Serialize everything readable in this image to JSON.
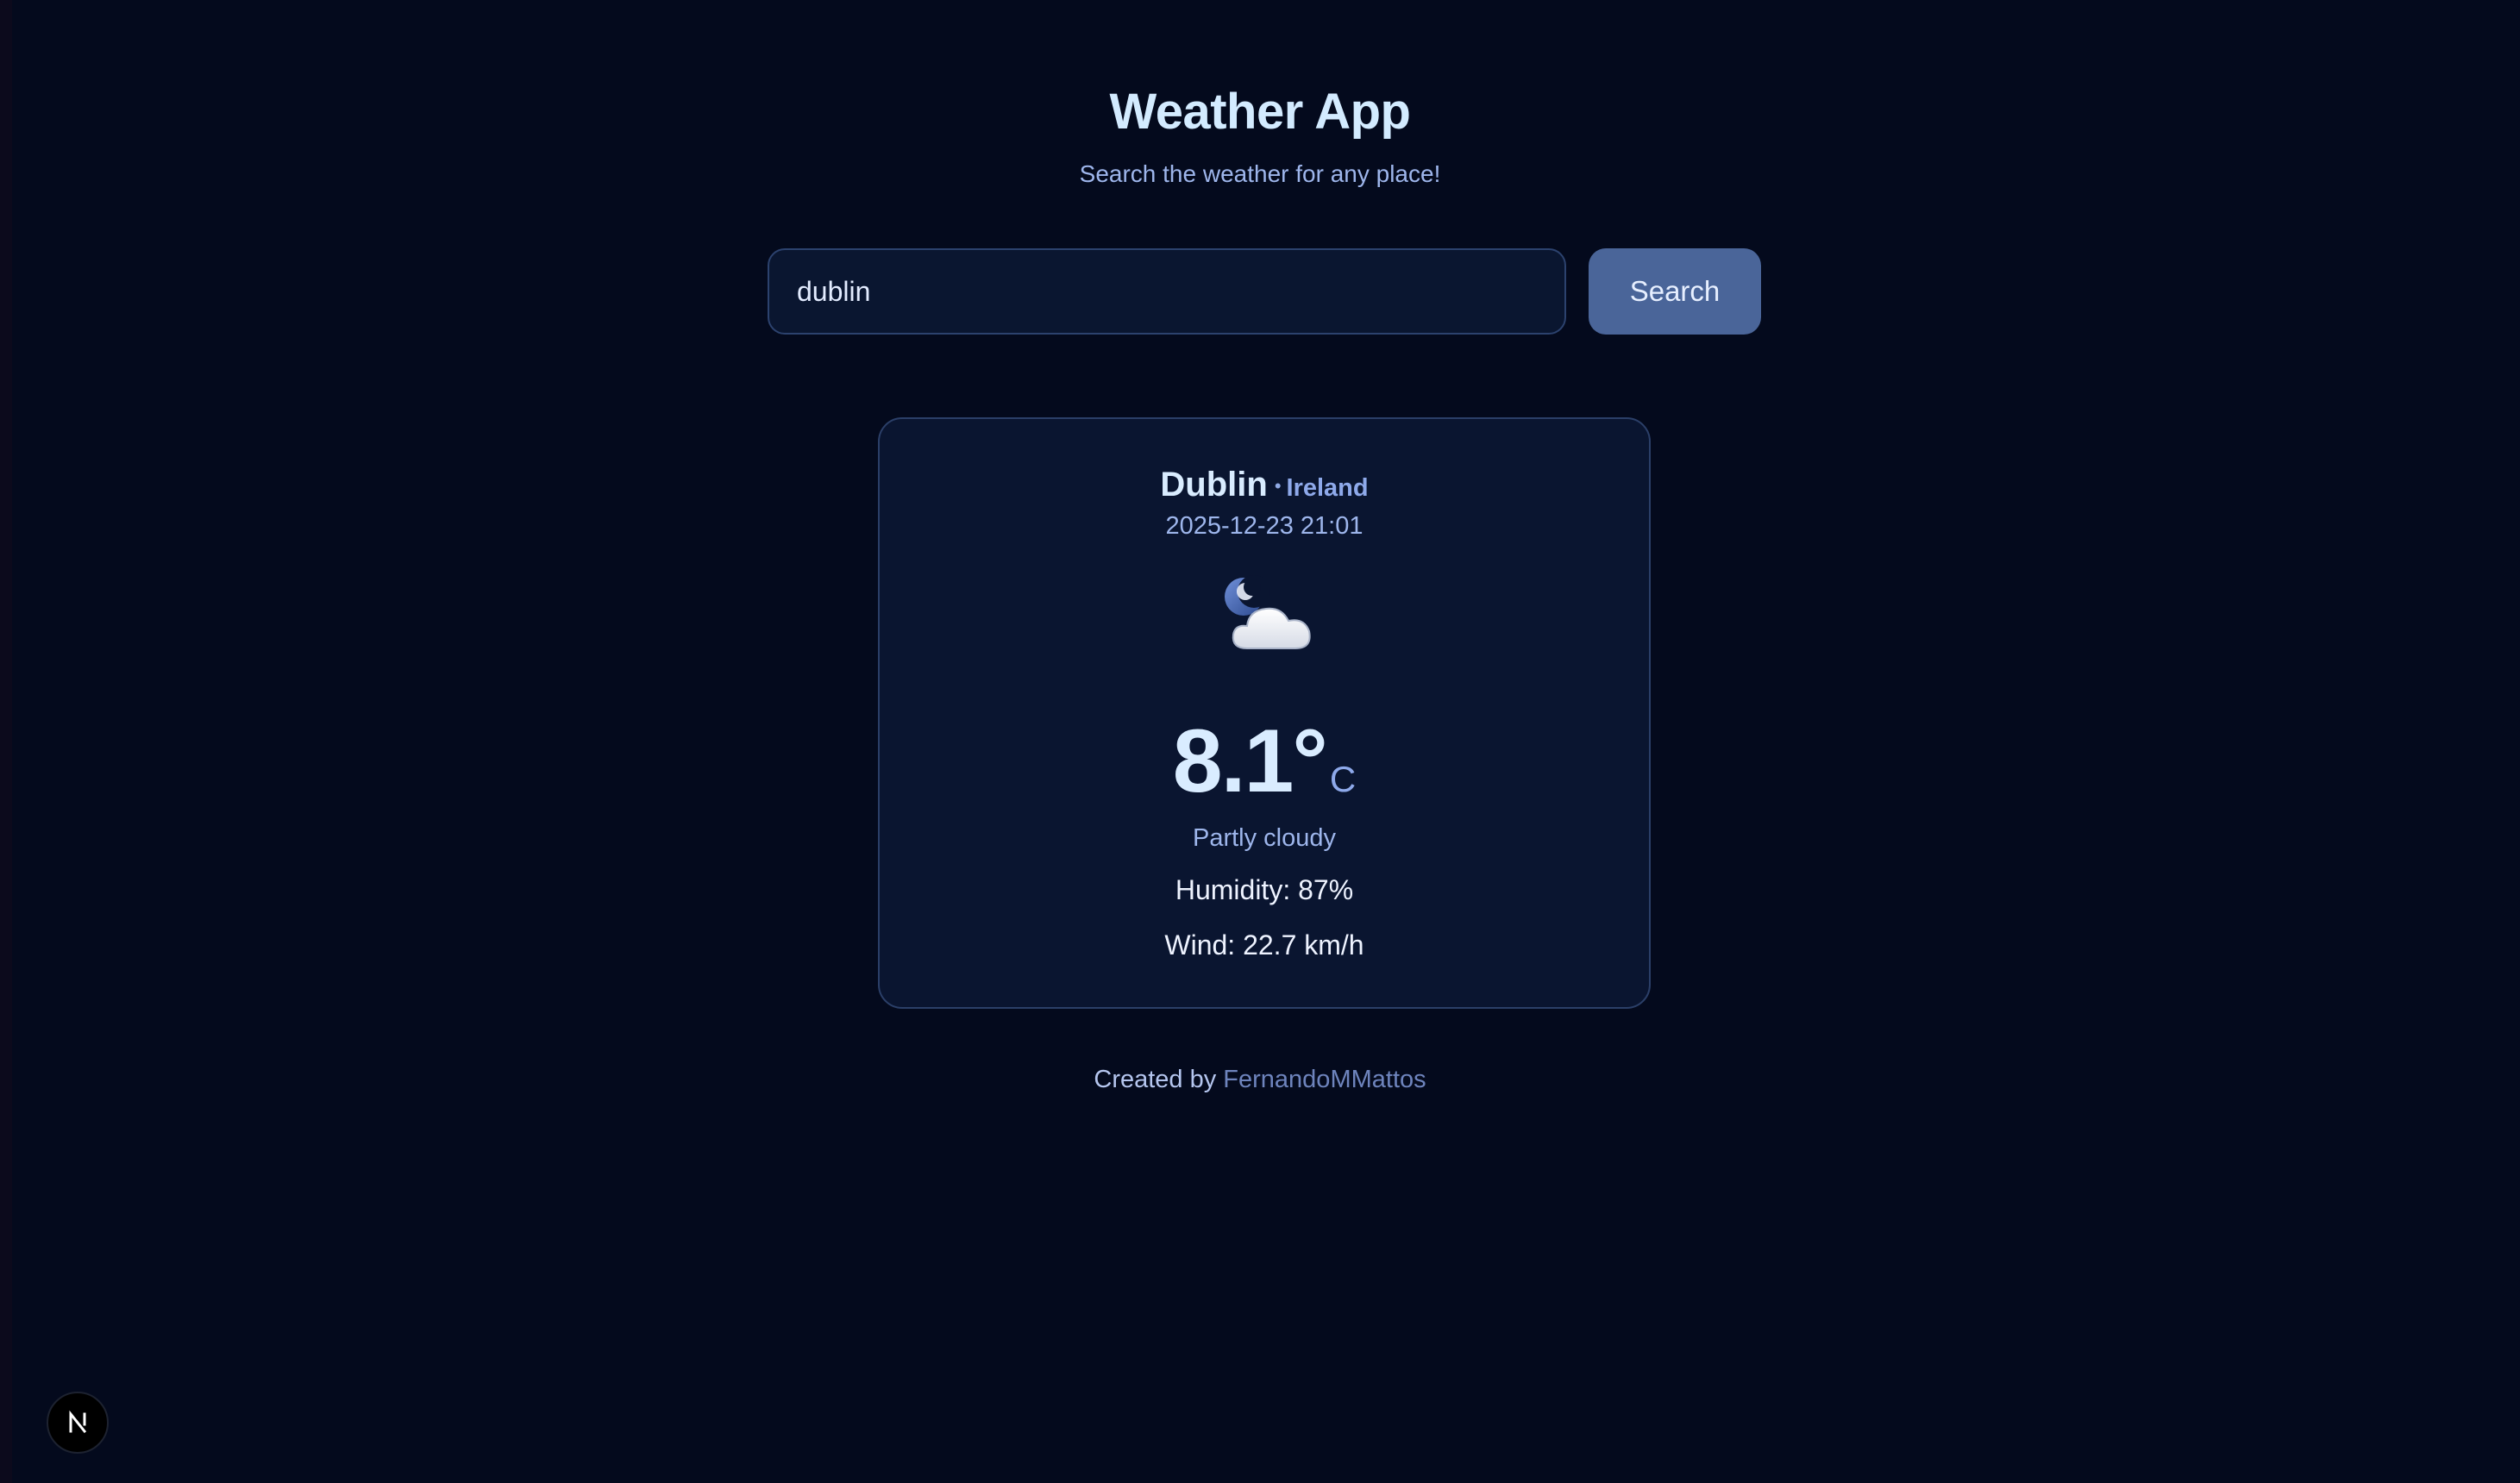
{
  "app": {
    "title": "Weather App",
    "subtitle": "Search the weather for any place!"
  },
  "search": {
    "value": "dublin",
    "button_label": "Search"
  },
  "weather": {
    "city": "Dublin",
    "separator": "•",
    "country": "Ireland",
    "datetime": "2025-12-23 21:01",
    "icon": "partly-cloudy-night-icon",
    "temperature": "8.1°",
    "unit": "C",
    "condition": "Partly cloudy",
    "humidity": "Humidity: 87%",
    "wind": "Wind: 22.7 km/h"
  },
  "footer": {
    "prefix": "Created by",
    "author": "FernandoMMattos"
  },
  "colors": {
    "background": "#040a1d",
    "card": "#0a1530",
    "accent_button": "#4a6599",
    "heading": "#d9ecff",
    "muted": "#9eb6ec"
  }
}
